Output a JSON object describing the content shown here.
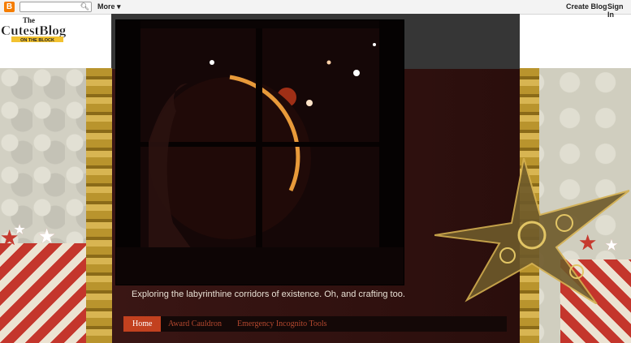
{
  "navbar": {
    "logo_letter": "B",
    "search_placeholder": "",
    "more_label": "More ▾",
    "create_blog_label": "Create Blog",
    "sign_in_label": "Sign In"
  },
  "site_logo": {
    "line1": "The",
    "line2": "CutestBlog",
    "line3": "ON THE BLOCK"
  },
  "blog": {
    "tagline": "Exploring the labyrinthine corridors of existence. Oh, and crafting too."
  },
  "menu": {
    "items": [
      {
        "label": "Home"
      },
      {
        "label": "Award Cauldron"
      },
      {
        "label": "Emergency Incognito Tools"
      }
    ]
  },
  "colors": {
    "accent": "#c2411f",
    "menu_text": "#b5482f",
    "page_dark": "#1e1210"
  }
}
